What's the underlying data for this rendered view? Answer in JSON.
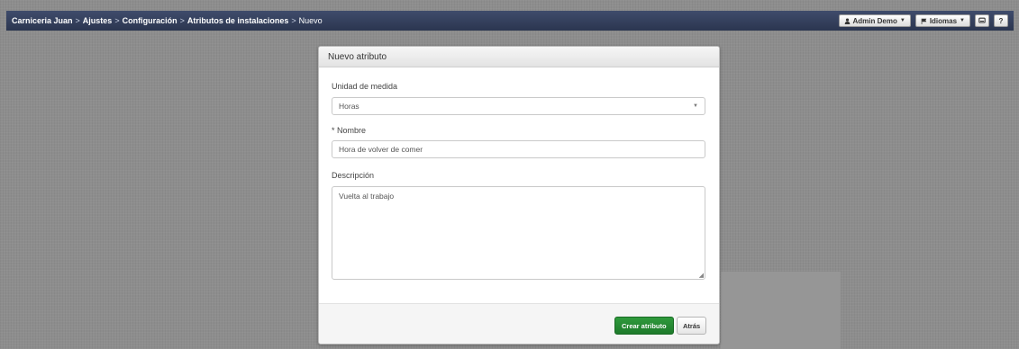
{
  "breadcrumb": {
    "items": [
      "Carniceria Juan",
      "Ajustes",
      "Configuración",
      "Atributos de instalaciones"
    ],
    "current": "Nuevo",
    "separator": ">"
  },
  "topbar": {
    "user_icon": "user-icon",
    "user_label": "Admin Demo",
    "lang_icon": "flag-icon",
    "lang_label": "Idiomas",
    "chat_icon": "chat-icon",
    "help_label": "?"
  },
  "modal": {
    "title": "Nuevo atributo",
    "unit_label": "Unidad de medida",
    "unit_value": "Horas",
    "name_label": "* Nombre",
    "name_value": "Hora de volver de comer",
    "description_label": "Descripción",
    "description_value": "Vuelta al trabajo",
    "create_button": "Crear atributo",
    "back_button": "Atrás"
  },
  "colors": {
    "topbar": "#2f3a55",
    "primary_button": "#237f2f",
    "background": "#8d8d8d"
  }
}
